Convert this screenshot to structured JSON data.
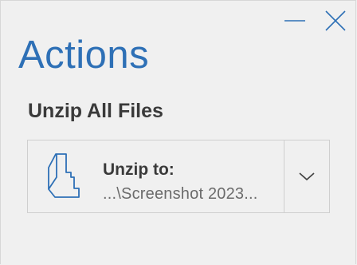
{
  "window": {
    "minimize_icon": "minimize-icon",
    "close_icon": "close-icon"
  },
  "pane": {
    "title": "Actions",
    "accent_color": "#2e70b6"
  },
  "section": {
    "title": "Unzip All Files"
  },
  "unzip_button": {
    "label": "Unzip to:",
    "path": "...\\Screenshot 2023...",
    "icon": "zip-file-icon",
    "dropdown_icon": "chevron-down-icon"
  }
}
